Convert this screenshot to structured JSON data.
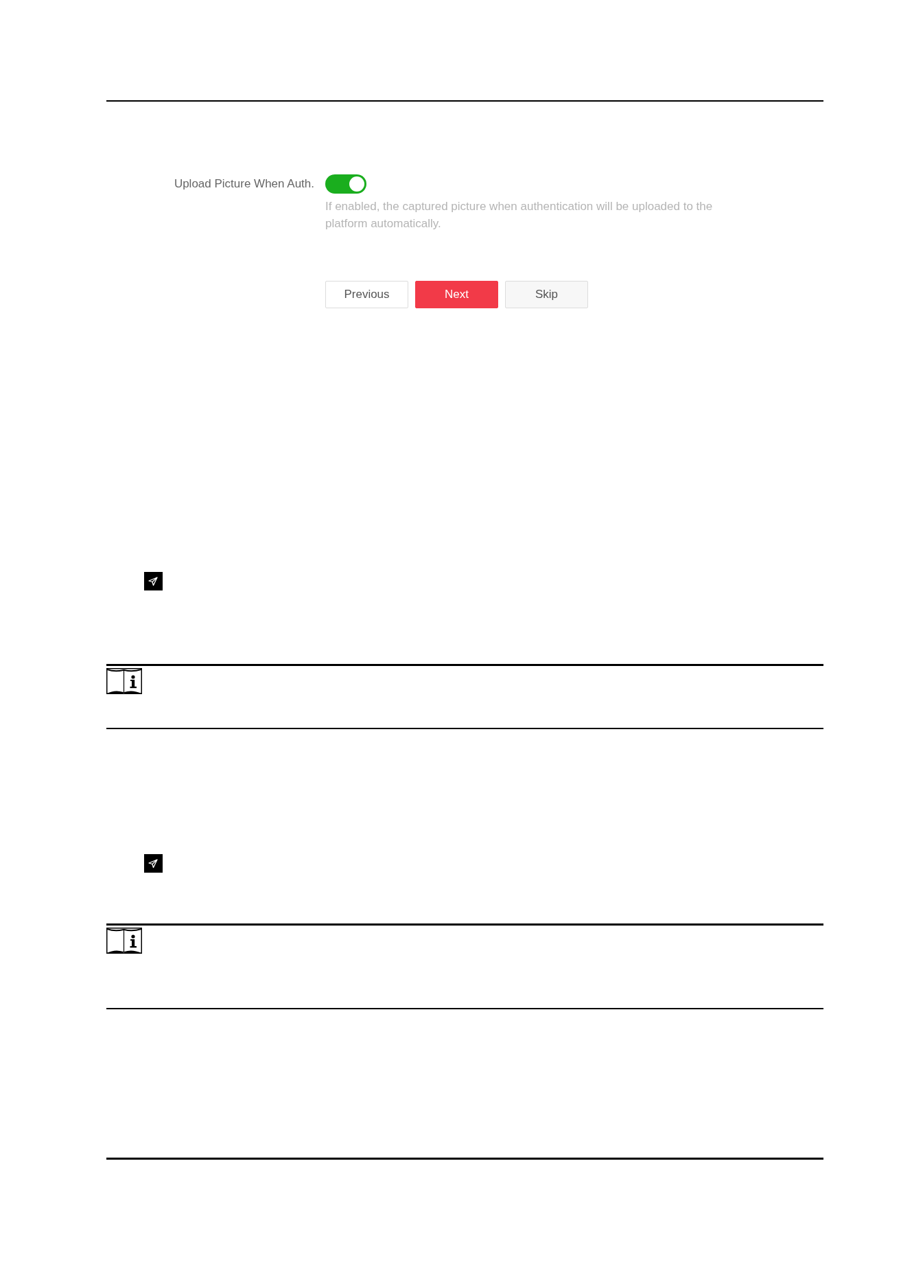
{
  "form": {
    "field": {
      "label": "Upload Picture When Auth.",
      "on": true,
      "hint": "If enabled, the captured picture when authentication will be uploaded to the platform automatically."
    },
    "buttons": [
      {
        "label": "Previous",
        "kind": "outline"
      },
      {
        "label": "Next",
        "kind": "primary"
      },
      {
        "label": "Skip",
        "kind": "plain"
      }
    ]
  }
}
